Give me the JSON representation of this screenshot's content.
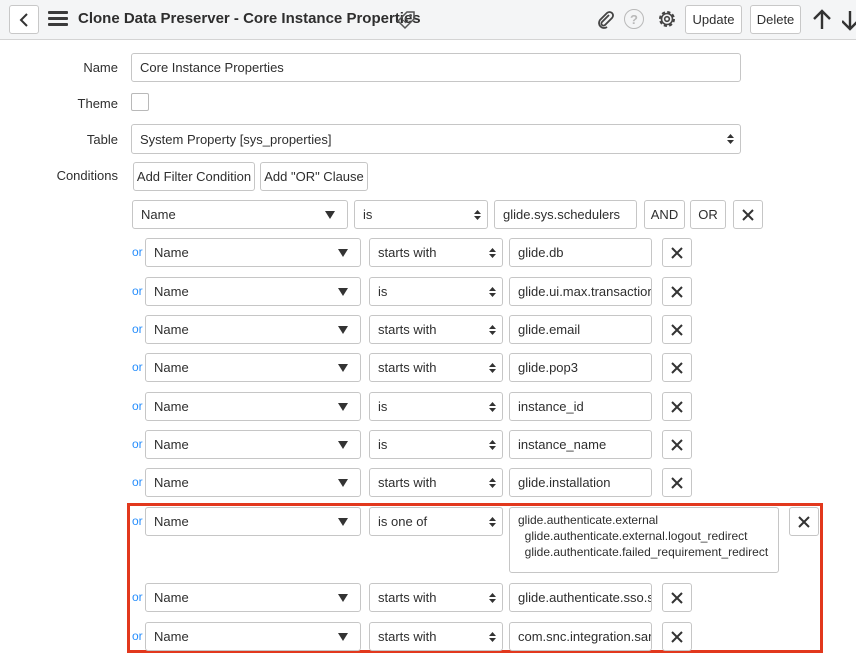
{
  "header": {
    "title": "Clone Data Preserver - Core Instance Properties",
    "update_label": "Update",
    "delete_label": "Delete",
    "help_glyph": "?"
  },
  "form": {
    "name_label": "Name",
    "name_value": "Core Instance Properties",
    "theme_label": "Theme",
    "theme_checked": false,
    "table_label": "Table",
    "table_value": "System Property [sys_properties]",
    "conditions_label": "Conditions"
  },
  "conditions": {
    "add_filter_label": "Add Filter Condition",
    "add_or_label": "Add \"OR\" Clause",
    "and_label": "AND",
    "or_button_label": "OR",
    "or_prefix": "or",
    "first_row": {
      "field": "Name",
      "operator": "is",
      "value": "glide.sys.schedulers"
    },
    "rows": [
      {
        "field": "Name",
        "operator": "starts with",
        "value": "glide.db"
      },
      {
        "field": "Name",
        "operator": "is",
        "value": "glide.ui.max.transaction"
      },
      {
        "field": "Name",
        "operator": "starts with",
        "value": "glide.email"
      },
      {
        "field": "Name",
        "operator": "starts with",
        "value": "glide.pop3"
      },
      {
        "field": "Name",
        "operator": "is",
        "value": "instance_id"
      },
      {
        "field": "Name",
        "operator": "is",
        "value": "instance_name"
      },
      {
        "field": "Name",
        "operator": "starts with",
        "value": "glide.installation"
      }
    ],
    "highlighted_rows": [
      {
        "field": "Name",
        "operator": "is one of",
        "value": "glide.authenticate.external\n  glide.authenticate.external.logout_redirect\n  glide.authenticate.failed_requirement_redirect"
      },
      {
        "field": "Name",
        "operator": "starts with",
        "value": "glide.authenticate.sso.sa"
      },
      {
        "field": "Name",
        "operator": "starts with",
        "value": "com.snc.integration.sam"
      }
    ],
    "highlight_color": "#e2381d",
    "or_color": "#278efc"
  },
  "icons": {
    "back": "chevron-left-icon",
    "menu": "hamburger-menu-icon",
    "tag": "tag-icon",
    "attachment": "paperclip-icon",
    "help": "help-circle-icon",
    "settings": "gear-icon",
    "up": "arrow-up-icon",
    "down": "arrow-down-icon",
    "remove": "close-icon"
  }
}
